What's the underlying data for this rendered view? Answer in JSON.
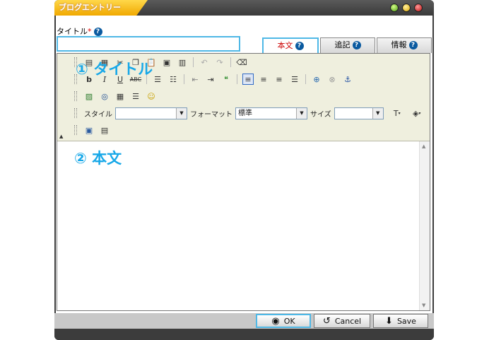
{
  "window": {
    "title": "ブログエントリー"
  },
  "title_field": {
    "label": "タイトル",
    "required_mark": "*",
    "value": "",
    "placeholder": ""
  },
  "tabs": [
    {
      "label": "本文",
      "active": true
    },
    {
      "label": "追記",
      "active": false
    },
    {
      "label": "情報",
      "active": false
    }
  ],
  "toolbar": {
    "style_label": "スタイル",
    "style_value": "",
    "format_label": "フォーマット",
    "format_value": "標準",
    "size_label": "サイズ",
    "size_value": ""
  },
  "annotations": {
    "a1": "① タイトル",
    "a2": "② 本文"
  },
  "footer": {
    "ok": "OK",
    "cancel": "Cancel",
    "save": "Save"
  },
  "colors": {
    "accent": "#4fb8e6",
    "title_tab": "#f0a800",
    "annotation": "#18a8e8"
  }
}
